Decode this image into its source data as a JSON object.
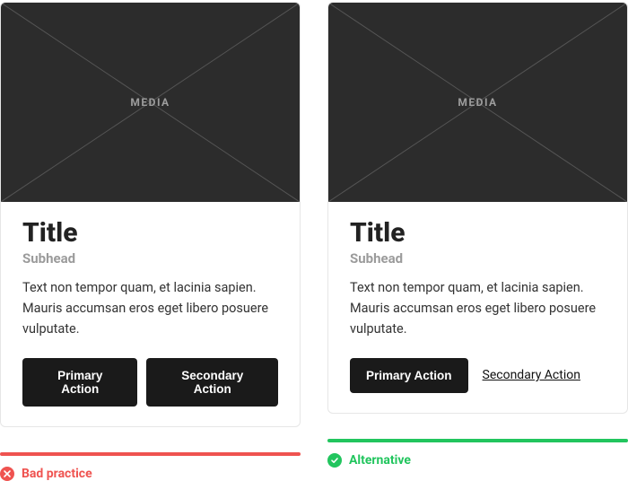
{
  "colors": {
    "bad": "#ef5350",
    "good": "#22c55e",
    "card_bg": "#ffffff",
    "media_bg": "#2c2c2c",
    "btn_bg": "#1a1a1a"
  },
  "examples": {
    "bad": {
      "media_label": "MEDIA",
      "title": "Title",
      "subhead": "Subhead",
      "description": "Text non tempor quam, et lacinia sapien. Mauris accumsan eros eget libero posuere vulputate.",
      "primary_label": "Primary Action",
      "secondary_label": "Secondary Action",
      "secondary_style": "button",
      "verdict_label": "Bad practice"
    },
    "good": {
      "media_label": "MEDIA",
      "title": "Title",
      "subhead": "Subhead",
      "description": "Text non tempor quam, et lacinia sapien. Mauris accumsan eros eget libero posuere vulputate.",
      "primary_label": "Primary Action",
      "secondary_label": "Secondary Action",
      "secondary_style": "link",
      "verdict_label": "Alternative"
    }
  }
}
